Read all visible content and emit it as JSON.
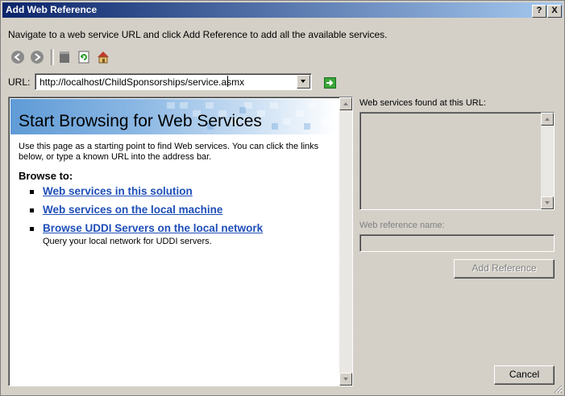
{
  "window": {
    "title": "Add Web Reference",
    "help_label": "?",
    "close_label": "X"
  },
  "instructions": "Navigate to a web service URL and click Add Reference to add all the available services.",
  "toolbar": {
    "back_icon": "back-arrow-icon",
    "forward_icon": "forward-arrow-icon",
    "stop_icon": "stop-icon",
    "refresh_icon": "refresh-icon",
    "home_icon": "home-icon"
  },
  "url": {
    "label": "URL:",
    "value": "http://localhost/ChildSponsorships/service.asmx"
  },
  "browser": {
    "title": "Start Browsing for Web Services",
    "intro": "Use this page as a starting point to find Web services. You can click the links below, or type a known URL into the address bar.",
    "browse_to": "Browse to:",
    "links": [
      {
        "label": "Web services in this solution",
        "description": ""
      },
      {
        "label": "Web services on the local machine",
        "description": ""
      },
      {
        "label": "Browse UDDI Servers on the local network",
        "description": "Query your local network for UDDI servers."
      }
    ]
  },
  "right_panel": {
    "found_label": "Web services found at this URL:",
    "ref_name_label": "Web reference name:",
    "ref_name_value": "",
    "add_reference_label": "Add Reference",
    "cancel_label": "Cancel"
  },
  "colors": {
    "title_bar": "#0a246a",
    "link": "#1f4fb8",
    "dialog_face": "#d4d0c8"
  }
}
